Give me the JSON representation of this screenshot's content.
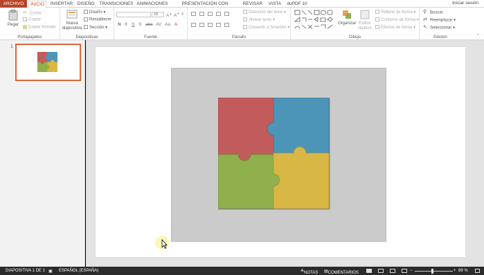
{
  "tabs": {
    "file": "ARCHIVO",
    "items": [
      "INICIO",
      "INSERTAR",
      "DISEÑO",
      "TRANSICIONES",
      "ANIMACIONES",
      "PRESENTACIÓN CON DIAPOSITIVAS",
      "REVISAR",
      "VISTA",
      "doPDF 10"
    ],
    "signin": "Iniciar sesión"
  },
  "clipboard": {
    "paste": "Pegar",
    "cut": "Cortar",
    "copy": "Copiar",
    "format_painter": "Copiar formato",
    "label": "Portapapeles"
  },
  "slides_group": {
    "new_slide": "Nueva",
    "new_slide2": "diapositiva",
    "layout": "Diseño",
    "reset": "Restablecer",
    "section": "Sección",
    "label": "Diapositivas"
  },
  "font_group": {
    "font_size": "18",
    "label": "Fuente"
  },
  "paragraph_group": {
    "text_direction": "Dirección del texto",
    "align_text": "Alinear texto",
    "smartart": "Convertir a SmartArt",
    "label": "Párrafo"
  },
  "drawing_group": {
    "arrange": "Organizar",
    "quick_styles": "Estilos",
    "quick_styles2": "rápidos",
    "shape_fill": "Relleno de forma",
    "shape_outline": "Contorno de forma",
    "shape_effects": "Efectos de forma",
    "label": "Dibujo"
  },
  "editing_group": {
    "find": "Buscar",
    "replace": "Reemplazar",
    "select": "Seleccionar",
    "label": "Edición"
  },
  "thumbnails": {
    "slide_number": "1"
  },
  "status": {
    "slide_info": "DIAPOSITIVA 1 DE 1",
    "language": "ESPAÑOL (ESPAÑA)",
    "notes": "NOTAS",
    "comments": "COMENTARIOS",
    "zoom_minus": "−",
    "zoom_plus": "+",
    "zoom_level": "89 %"
  },
  "colors": {
    "accent": "#d24726",
    "file_tab": "#b7472a",
    "puzzle_red": "#c25b5b",
    "puzzle_blue": "#4e95b8",
    "puzzle_green": "#8fb04d",
    "puzzle_yellow": "#d9b744"
  }
}
